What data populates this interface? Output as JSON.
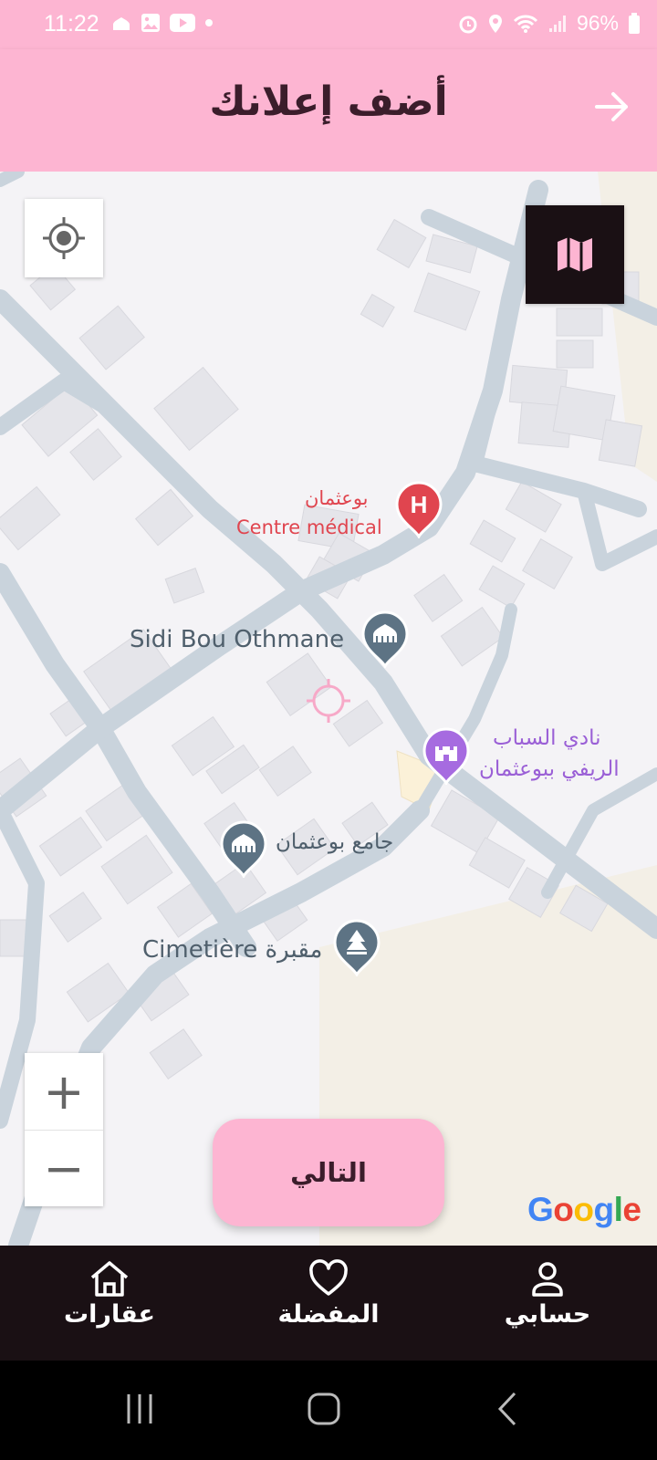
{
  "status_bar": {
    "time": "11:22",
    "battery": "96%",
    "left_icons": [
      "mosque-icon",
      "image-icon",
      "youtube-icon",
      "dot-icon"
    ],
    "right_icons": [
      "alarm-icon",
      "location-icon",
      "wifi-icon",
      "signal-icon",
      "battery-icon"
    ]
  },
  "header": {
    "title": "أضف إعلانك",
    "back_icon": "arrow-right-icon",
    "background": "#fdb5d2"
  },
  "map": {
    "pois": {
      "medical_line1": "بوعثمان",
      "medical_line2": "Centre médical",
      "sidi": "Sidi Bou Othmane",
      "club_line1": "نادي السباب",
      "club_line2": "الريفي ببوعثمان",
      "mosque": "جامع بوعثمان",
      "cemetery": "Cimetière مقبرة"
    },
    "zoom_in": "+",
    "zoom_out": "−",
    "attribution": [
      "G",
      "o",
      "o",
      "g",
      "l",
      "e"
    ]
  },
  "next_button": "التالي",
  "bottom_nav": {
    "items": [
      {
        "label": "حسابي",
        "icon": "person-icon"
      },
      {
        "label": "المفضلة",
        "icon": "heart-icon"
      },
      {
        "label": "عقارات",
        "icon": "home-icon"
      }
    ]
  },
  "colors": {
    "accent": "#fdb5d2",
    "dark": "#1a1014",
    "medical": "#e0454f",
    "club": "#a66be0",
    "poi_gray": "#5d7384"
  }
}
